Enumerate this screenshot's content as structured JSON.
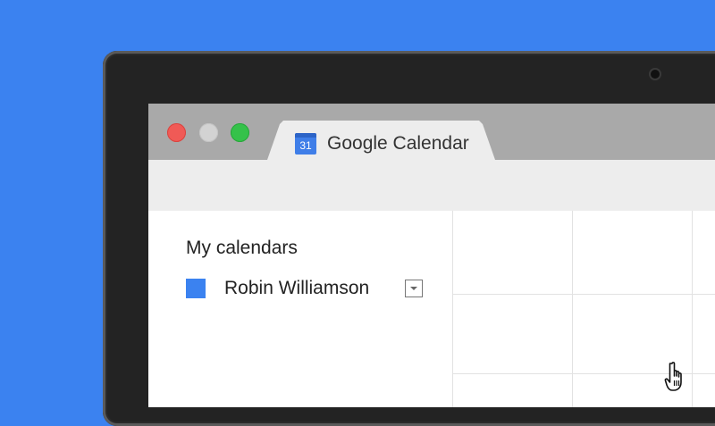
{
  "window": {
    "tab": {
      "icon": "calendar-icon",
      "icon_number": "31",
      "title": "Google Calendar"
    },
    "traffic_lights": [
      "close",
      "minimize",
      "maximize"
    ]
  },
  "sidebar": {
    "section_title": "My calendars",
    "calendars": [
      {
        "name": "Robin Williamson",
        "color": "#3b82f0"
      }
    ]
  },
  "colors": {
    "background": "#3b82f0",
    "close": "#f05a56",
    "minimize": "#d3d3d3",
    "maximize": "#35c24a"
  },
  "cursor": "hand-pointer-icon"
}
